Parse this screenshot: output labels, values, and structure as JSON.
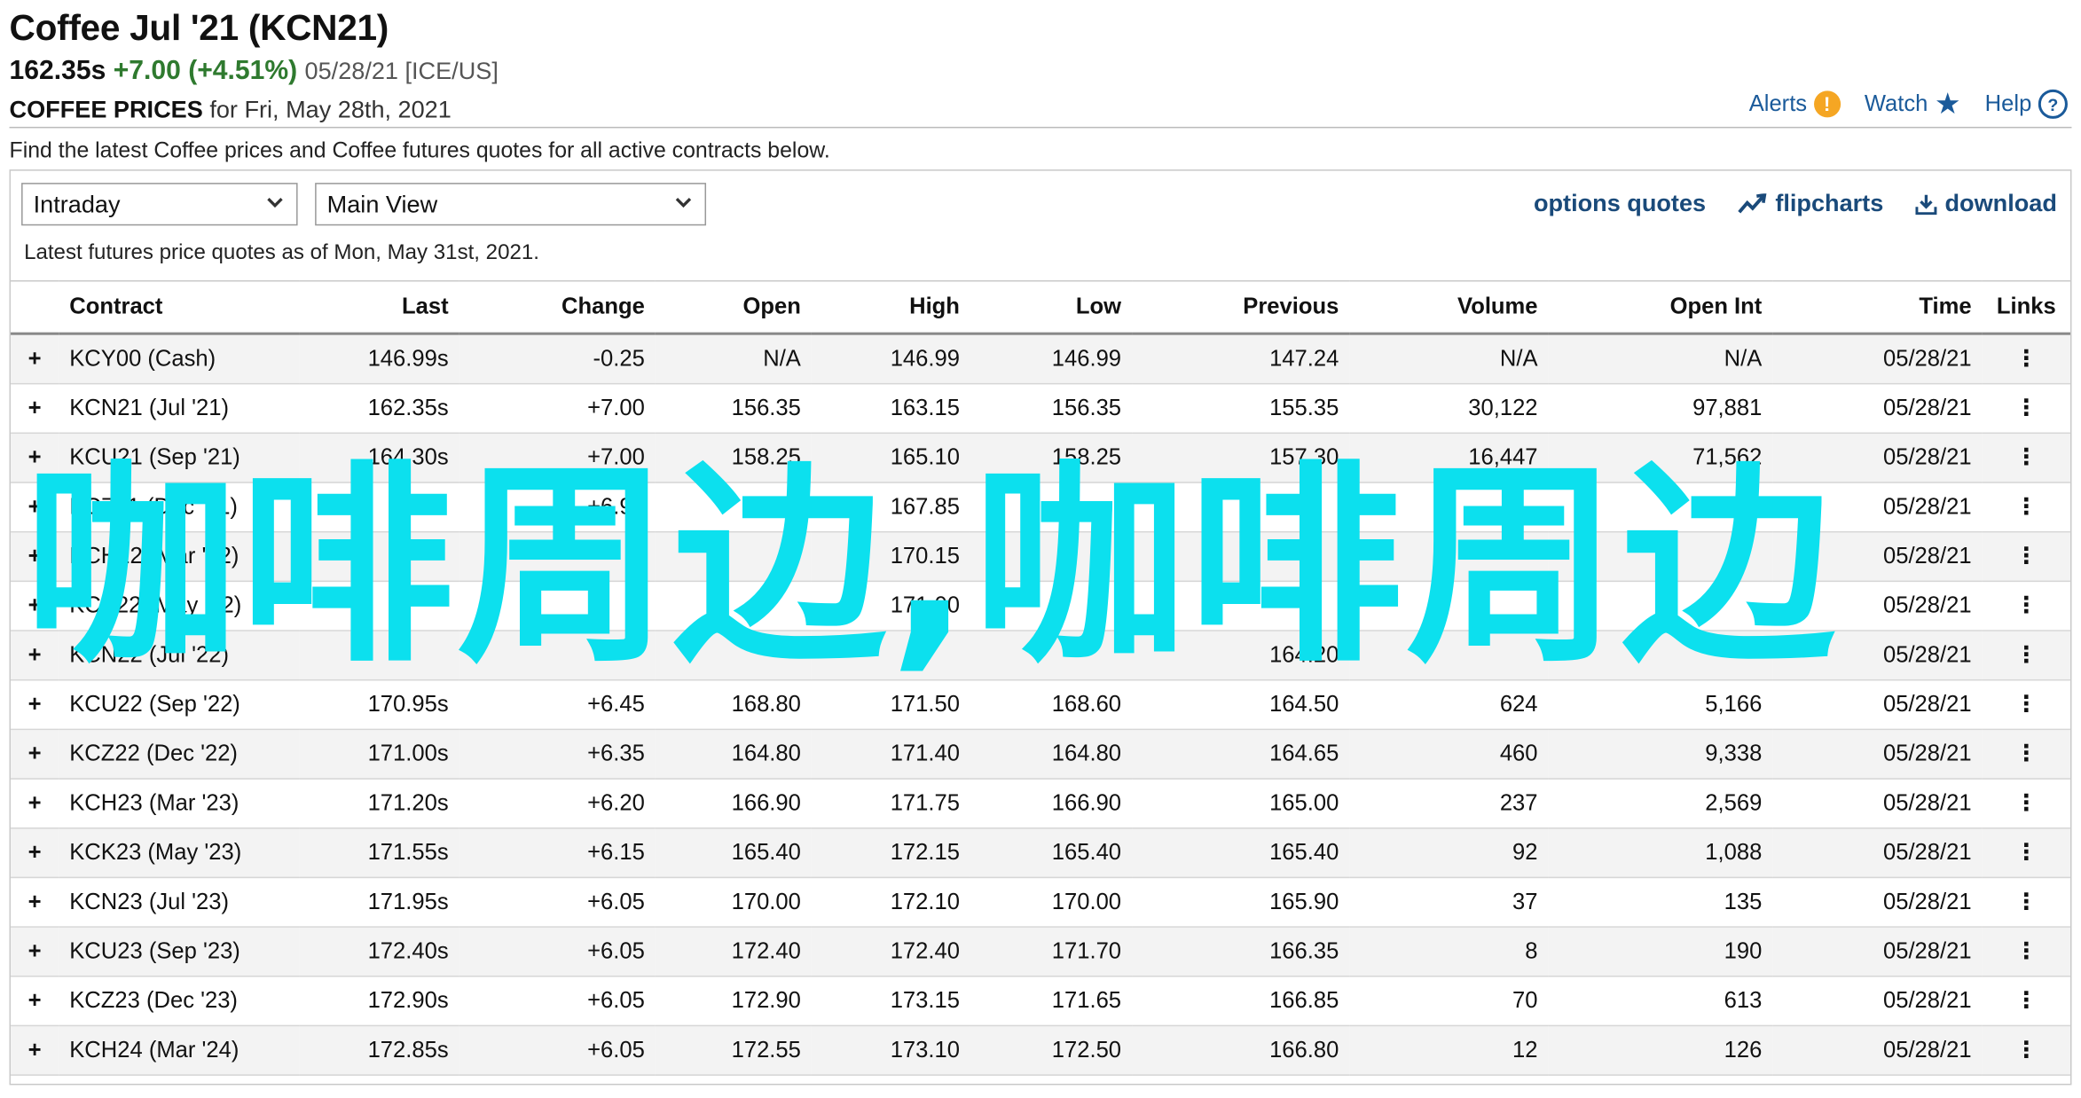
{
  "header": {
    "title": "Coffee Jul '21 (KCN21)",
    "last": "162.35s",
    "change": "+7.00 (+4.51%)",
    "date_exchange": "05/28/21 [ICE/US]",
    "prices_label": "COFFEE PRICES",
    "prices_for": "for Fri, May 28th, 2021"
  },
  "toplinks": {
    "alerts": "Alerts",
    "alerts_icon": "!",
    "watch": "Watch",
    "help": "Help",
    "help_icon": "?"
  },
  "intro": "Find the latest Coffee prices and Coffee futures quotes for all active contracts below.",
  "controls": {
    "period": "Intraday",
    "view": "Main View"
  },
  "tools": {
    "options_quotes": "options quotes",
    "flipcharts": "flipcharts",
    "download": "download"
  },
  "asof": "Latest futures price quotes as of Mon, May 31st, 2021.",
  "columns": [
    "Contract",
    "Last",
    "Change",
    "Open",
    "High",
    "Low",
    "Previous",
    "Volume",
    "Open Int",
    "Time",
    "Links"
  ],
  "rows": [
    {
      "contract": "KCY00 (Cash)",
      "last": "146.99s",
      "change": "-0.25",
      "dir": "down",
      "open": "N/A",
      "high": "146.99",
      "low": "146.99",
      "previous": "147.24",
      "volume": "N/A",
      "open_int": "N/A",
      "time": "05/28/21"
    },
    {
      "contract": "KCN21 (Jul '21)",
      "last": "162.35s",
      "change": "+7.00",
      "dir": "up",
      "open": "156.35",
      "high": "163.15",
      "low": "156.35",
      "previous": "155.35",
      "volume": "30,122",
      "open_int": "97,881",
      "time": "05/28/21"
    },
    {
      "contract": "KCU21 (Sep '21)",
      "last": "164.30s",
      "change": "+7.00",
      "dir": "up",
      "open": "158.25",
      "high": "165.10",
      "low": "158.25",
      "previous": "157.30",
      "volume": "16,447",
      "open_int": "71,562",
      "time": "05/28/21"
    },
    {
      "contract": "KCZ21 (Dec '21)",
      "last": "",
      "change": "+6.90",
      "dir": "up",
      "open": "",
      "high": "167.85",
      "low": "",
      "previous": "",
      "volume": "",
      "open_int": "",
      "time": "05/28/21"
    },
    {
      "contract": "KCH22 (Mar '22)",
      "last": "",
      "change": "",
      "dir": "up",
      "open": "",
      "high": "170.15",
      "low": "",
      "previous": "",
      "volume": "",
      "open_int": "",
      "time": "05/28/21"
    },
    {
      "contract": "KCK22 (May '22)",
      "last": "",
      "change": "",
      "dir": "up",
      "open": "",
      "high": "171.00",
      "low": "",
      "previous": "",
      "volume": "",
      "open_int": "",
      "time": "05/28/21"
    },
    {
      "contract": "KCN22 (Jul '22)",
      "last": "",
      "change": "",
      "dir": "up",
      "open": "",
      "high": "",
      "low": "",
      "previous": "164.20",
      "volume": "",
      "open_int": "",
      "time": "05/28/21"
    },
    {
      "contract": "KCU22 (Sep '22)",
      "last": "170.95s",
      "change": "+6.45",
      "dir": "up",
      "open": "168.80",
      "high": "171.50",
      "low": "168.60",
      "previous": "164.50",
      "volume": "624",
      "open_int": "5,166",
      "time": "05/28/21"
    },
    {
      "contract": "KCZ22 (Dec '22)",
      "last": "171.00s",
      "change": "+6.35",
      "dir": "up",
      "open": "164.80",
      "high": "171.40",
      "low": "164.80",
      "previous": "164.65",
      "volume": "460",
      "open_int": "9,338",
      "time": "05/28/21"
    },
    {
      "contract": "KCH23 (Mar '23)",
      "last": "171.20s",
      "change": "+6.20",
      "dir": "up",
      "open": "166.90",
      "high": "171.75",
      "low": "166.90",
      "previous": "165.00",
      "volume": "237",
      "open_int": "2,569",
      "time": "05/28/21"
    },
    {
      "contract": "KCK23 (May '23)",
      "last": "171.55s",
      "change": "+6.15",
      "dir": "up",
      "open": "165.40",
      "high": "172.15",
      "low": "165.40",
      "previous": "165.40",
      "volume": "92",
      "open_int": "1,088",
      "time": "05/28/21"
    },
    {
      "contract": "KCN23 (Jul '23)",
      "last": "171.95s",
      "change": "+6.05",
      "dir": "up",
      "open": "170.00",
      "high": "172.10",
      "low": "170.00",
      "previous": "165.90",
      "volume": "37",
      "open_int": "135",
      "time": "05/28/21"
    },
    {
      "contract": "KCU23 (Sep '23)",
      "last": "172.40s",
      "change": "+6.05",
      "dir": "up",
      "open": "172.40",
      "high": "172.40",
      "low": "171.70",
      "previous": "166.35",
      "volume": "8",
      "open_int": "190",
      "time": "05/28/21"
    },
    {
      "contract": "KCZ23 (Dec '23)",
      "last": "172.90s",
      "change": "+6.05",
      "dir": "up",
      "open": "172.90",
      "high": "173.15",
      "low": "171.65",
      "previous": "166.85",
      "volume": "70",
      "open_int": "613",
      "time": "05/28/21"
    },
    {
      "contract": "KCH24 (Mar '24)",
      "last": "172.85s",
      "change": "+6.05",
      "dir": "up",
      "open": "172.55",
      "high": "173.10",
      "low": "172.50",
      "previous": "166.80",
      "volume": "12",
      "open_int": "126",
      "time": "05/28/21"
    }
  ],
  "watermark": "咖啡周边,咖啡周边",
  "colors": {
    "link": "#1a5a9a",
    "up": "#2f7a2f",
    "down": "#c81e1e",
    "watermark": "#0ce0ee",
    "alert": "#f5a623"
  }
}
